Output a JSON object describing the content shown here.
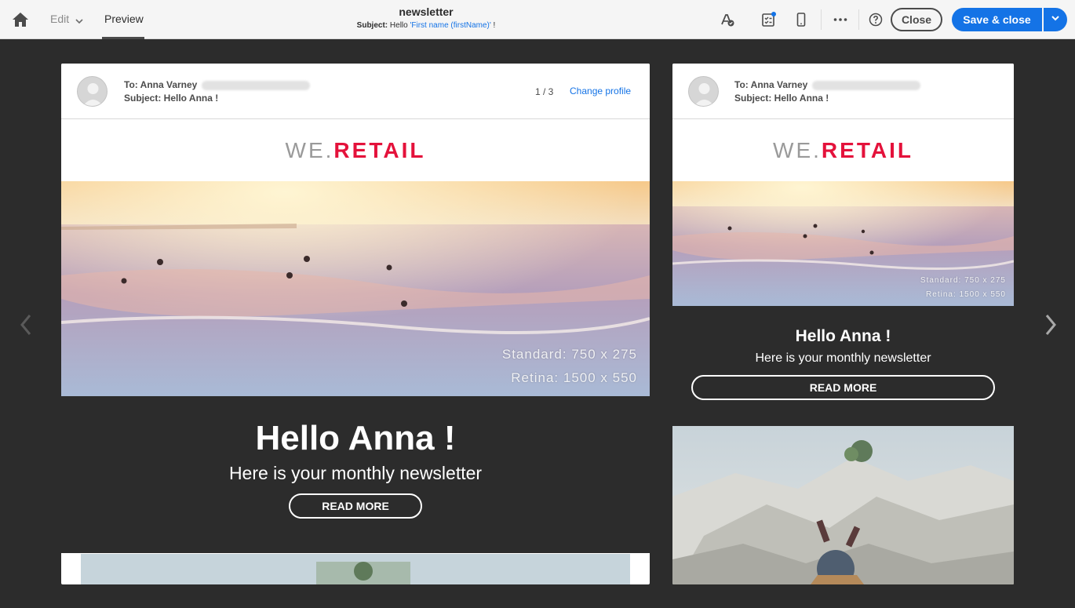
{
  "topbar": {
    "edit_label": "Edit",
    "preview_label": "Preview",
    "title": "newsletter",
    "subject_label": "Subject:",
    "subject_prefix": "Hello",
    "subject_personalization": "'First name (firstName)'",
    "subject_suffix": "!",
    "close_label": "Close",
    "save_close_label": "Save & close"
  },
  "colors": {
    "accent": "#1473e6",
    "brand_red": "#e4123b",
    "dark_bg": "#2c2c2c"
  },
  "preview_left": {
    "to_label": "To: Anna Varney",
    "subject": "Subject: Hello Anna !",
    "pager": "1 / 3",
    "change_profile": "Change profile",
    "logo_we": "WE.",
    "logo_retail": "RETAIL",
    "caption_standard": "Standard: 750 x 275",
    "caption_retina": "Retina: 1500 x 550",
    "greeting": "Hello Anna !",
    "tagline": "Here is your monthly newsletter",
    "read_more": "READ MORE"
  },
  "preview_right": {
    "to_label": "To: Anna Varney",
    "subject": "Subject: Hello Anna !",
    "logo_we": "WE.",
    "logo_retail": "RETAIL",
    "caption_standard": "Standard: 750 x 275",
    "caption_retina": "Retina: 1500 x 550",
    "greeting": "Hello Anna !",
    "tagline": "Here is your monthly newsletter",
    "read_more": "READ MORE"
  }
}
